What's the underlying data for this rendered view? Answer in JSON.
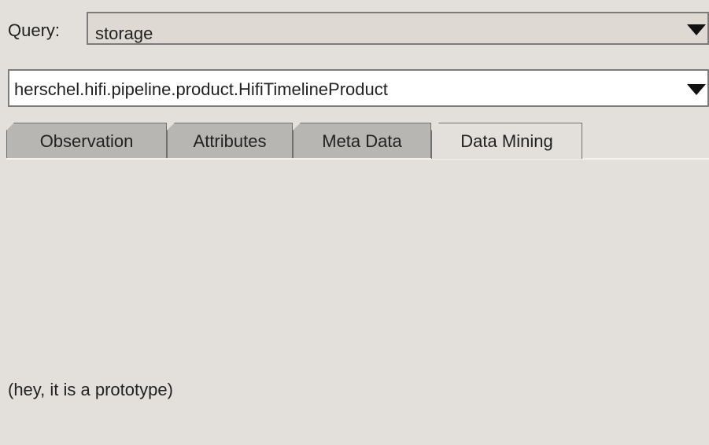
{
  "query": {
    "label": "Query:",
    "value": "storage"
  },
  "product": {
    "value": "herschel.hifi.pipeline.product.HifiTimelineProduct"
  },
  "tabs": [
    {
      "label": "Observation",
      "active": false
    },
    {
      "label": "Attributes",
      "active": false
    },
    {
      "label": "Meta Data",
      "active": false
    },
    {
      "label": "Data Mining",
      "active": true
    }
  ],
  "content": {
    "note": "(hey, it is a prototype)"
  },
  "icons": {
    "dropdown": "chevron-down-icon"
  },
  "colors": {
    "background": "#e3e0db",
    "tab_inactive": "#b8b6b2",
    "input_white": "#ffffff",
    "border": "#7c7c7c"
  }
}
